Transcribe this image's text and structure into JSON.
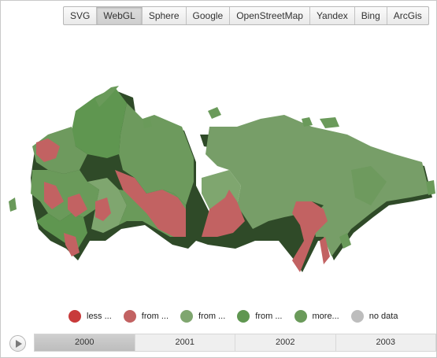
{
  "toolbar": {
    "buttons": [
      {
        "label": "SVG",
        "active": false
      },
      {
        "label": "WebGL",
        "active": true
      },
      {
        "label": "Sphere",
        "active": false
      },
      {
        "label": "Google",
        "active": false
      },
      {
        "label": "OpenStreetMap",
        "active": false
      },
      {
        "label": "Yandex",
        "active": false
      },
      {
        "label": "Bing",
        "active": false
      },
      {
        "label": "ArcGis",
        "active": false
      }
    ]
  },
  "colors": {
    "less": "#c83a3a",
    "from1": "#c26262",
    "from2": "#7fa66f",
    "from3": "#5f9650",
    "more": "#6a9a5a",
    "nodata": "#bdbdbd"
  },
  "legend": {
    "items": [
      {
        "label": "less ...",
        "color": "#c83a3a"
      },
      {
        "label": "from ...",
        "color": "#c26262"
      },
      {
        "label": "from ...",
        "color": "#7fa66f"
      },
      {
        "label": "from ...",
        "color": "#5f9650"
      },
      {
        "label": "more...",
        "color": "#6a9a5a"
      },
      {
        "label": "no data",
        "color": "#bdbdbd"
      }
    ]
  },
  "timeline": {
    "play_icon": "play-icon",
    "years": [
      "2000",
      "2001",
      "2002",
      "2003"
    ],
    "selected": "2000"
  }
}
